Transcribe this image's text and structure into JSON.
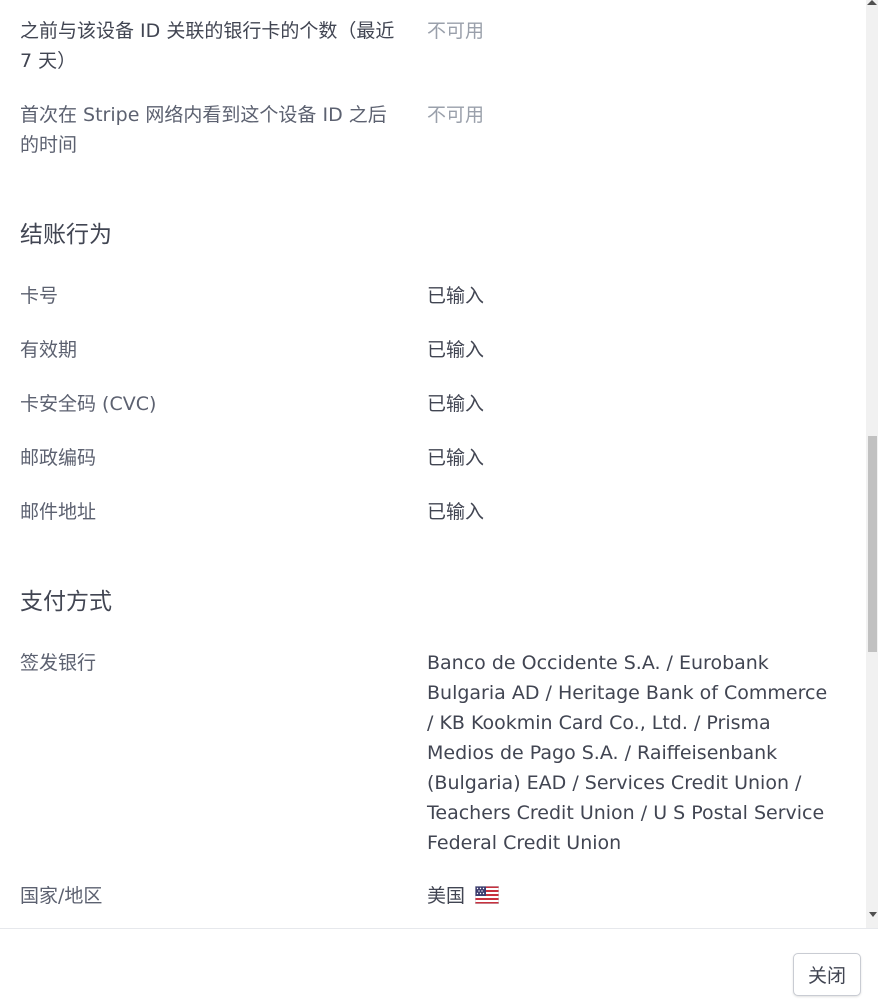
{
  "device_rows": [
    {
      "label": "之前与该设备 ID 关联的银行卡的个数（最近 7 天）",
      "value": "不可用"
    },
    {
      "label": "首次在 Stripe 网络内看到这个设备 ID 之后的时间",
      "value": "不可用"
    }
  ],
  "checkout_behavior": {
    "title": "结账行为",
    "rows": [
      {
        "label": "卡号",
        "value": "已输入"
      },
      {
        "label": "有效期",
        "value": "已输入"
      },
      {
        "label": "卡安全码 (CVC)",
        "value": "已输入"
      },
      {
        "label": "邮政编码",
        "value": "已输入"
      },
      {
        "label": "邮件地址",
        "value": "已输入"
      }
    ]
  },
  "payment_method": {
    "title": "支付方式",
    "issuing_bank_label": "签发银行",
    "issuing_bank_value": "Banco de Occidente S.A. / Eurobank Bulgaria AD / Heritage Bank of Commerce / KB Kookmin Card Co., Ltd. / Prisma Medios de Pago S.A. / Raiffeisenbank (Bulgaria) EAD / Services Credit Union / Teachers Credit Union / U S Postal Service Federal Credit Union",
    "country_label": "国家/地区",
    "country_value": "美国",
    "country_flag_icon": "us-flag-icon"
  },
  "footer": {
    "close_label": "关闭"
  },
  "colors": {
    "label": "#5c6170",
    "value": "#414552",
    "muted": "#9aa0ab"
  }
}
